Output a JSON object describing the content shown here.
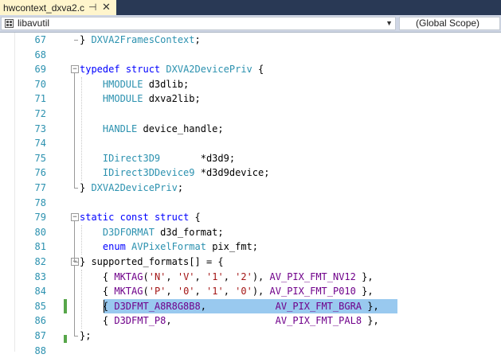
{
  "tab": {
    "title": "hwcontext_dxva2.c",
    "pin_icon": "pin-icon",
    "close_icon": "close-icon"
  },
  "nav": {
    "project": "libavutil",
    "scope": "(Global Scope)"
  },
  "colors": {
    "keyword": "#0000ff",
    "type": "#2b91af",
    "string": "#a31515",
    "macro": "#6f008a",
    "selection": "#99c9ef",
    "change_saved": "#57a64a"
  },
  "lines": [
    {
      "n": "67",
      "tokens": [
        [
          "p",
          "} "
        ],
        [
          "ty",
          "DXVA2FramesContext"
        ],
        [
          "p",
          ";"
        ]
      ]
    },
    {
      "n": "68",
      "tokens": []
    },
    {
      "n": "69",
      "tokens": [
        [
          "kw",
          "typedef"
        ],
        [
          "p",
          " "
        ],
        [
          "kw",
          "struct"
        ],
        [
          "p",
          " "
        ],
        [
          "ty",
          "DXVA2DevicePriv"
        ],
        [
          "p",
          " {"
        ]
      ]
    },
    {
      "n": "70",
      "tokens": [
        [
          "p",
          "    "
        ],
        [
          "ty",
          "HMODULE"
        ],
        [
          "p",
          " d3dlib;"
        ]
      ]
    },
    {
      "n": "71",
      "tokens": [
        [
          "p",
          "    "
        ],
        [
          "ty",
          "HMODULE"
        ],
        [
          "p",
          " dxva2lib;"
        ]
      ]
    },
    {
      "n": "72",
      "tokens": []
    },
    {
      "n": "73",
      "tokens": [
        [
          "p",
          "    "
        ],
        [
          "ty",
          "HANDLE"
        ],
        [
          "p",
          " device_handle;"
        ]
      ]
    },
    {
      "n": "74",
      "tokens": []
    },
    {
      "n": "75",
      "tokens": [
        [
          "p",
          "    "
        ],
        [
          "ty",
          "IDirect3D9"
        ],
        [
          "p",
          "       *d3d9;"
        ]
      ]
    },
    {
      "n": "76",
      "tokens": [
        [
          "p",
          "    "
        ],
        [
          "ty",
          "IDirect3DDevice9"
        ],
        [
          "p",
          " *d3d9device;"
        ]
      ]
    },
    {
      "n": "77",
      "tokens": [
        [
          "p",
          "} "
        ],
        [
          "ty",
          "DXVA2DevicePriv"
        ],
        [
          "p",
          ";"
        ]
      ]
    },
    {
      "n": "78",
      "tokens": []
    },
    {
      "n": "79",
      "tokens": [
        [
          "kw",
          "static"
        ],
        [
          "p",
          " "
        ],
        [
          "kw",
          "const"
        ],
        [
          "p",
          " "
        ],
        [
          "kw",
          "struct"
        ],
        [
          "p",
          " {"
        ]
      ]
    },
    {
      "n": "80",
      "tokens": [
        [
          "p",
          "    "
        ],
        [
          "ty",
          "D3DFORMAT"
        ],
        [
          "p",
          " d3d_format;"
        ]
      ]
    },
    {
      "n": "81",
      "tokens": [
        [
          "p",
          "    "
        ],
        [
          "kw",
          "enum"
        ],
        [
          "p",
          " "
        ],
        [
          "ty",
          "AVPixelFormat"
        ],
        [
          "p",
          " pix_fmt;"
        ]
      ]
    },
    {
      "n": "82",
      "tokens": [
        [
          "p",
          "} supported_formats[] = {"
        ]
      ]
    },
    {
      "n": "83",
      "tokens": [
        [
          "p",
          "    { "
        ],
        [
          "mc",
          "MKTAG"
        ],
        [
          "p",
          "("
        ],
        [
          "st",
          "'N'"
        ],
        [
          "p",
          ", "
        ],
        [
          "st",
          "'V'"
        ],
        [
          "p",
          ", "
        ],
        [
          "st",
          "'1'"
        ],
        [
          "p",
          ", "
        ],
        [
          "st",
          "'2'"
        ],
        [
          "p",
          "), "
        ],
        [
          "mc",
          "AV_PIX_FMT_NV12"
        ],
        [
          "p",
          " },"
        ]
      ]
    },
    {
      "n": "84",
      "tokens": [
        [
          "p",
          "    { "
        ],
        [
          "mc",
          "MKTAG"
        ],
        [
          "p",
          "("
        ],
        [
          "st",
          "'P'"
        ],
        [
          "p",
          ", "
        ],
        [
          "st",
          "'0'"
        ],
        [
          "p",
          ", "
        ],
        [
          "st",
          "'1'"
        ],
        [
          "p",
          ", "
        ],
        [
          "st",
          "'0'"
        ],
        [
          "p",
          "), "
        ],
        [
          "mc",
          "AV_PIX_FMT_P010"
        ],
        [
          "p",
          " },"
        ]
      ]
    },
    {
      "n": "85",
      "tokens": [
        [
          "p",
          "    { "
        ],
        [
          "mc",
          "D3DFMT_A8R8G8B8"
        ],
        [
          "p",
          ",            "
        ],
        [
          "mc",
          "AV_PIX_FMT_BGRA"
        ],
        [
          "p",
          " },"
        ]
      ]
    },
    {
      "n": "86",
      "tokens": [
        [
          "p",
          "    { "
        ],
        [
          "mc",
          "D3DFMT_P8"
        ],
        [
          "p",
          ",                  "
        ],
        [
          "mc",
          "AV_PIX_FMT_PAL8"
        ],
        [
          "p",
          " },"
        ]
      ]
    },
    {
      "n": "87",
      "tokens": [
        [
          "p",
          "};"
        ]
      ]
    },
    {
      "n": "88",
      "tokens": []
    }
  ]
}
